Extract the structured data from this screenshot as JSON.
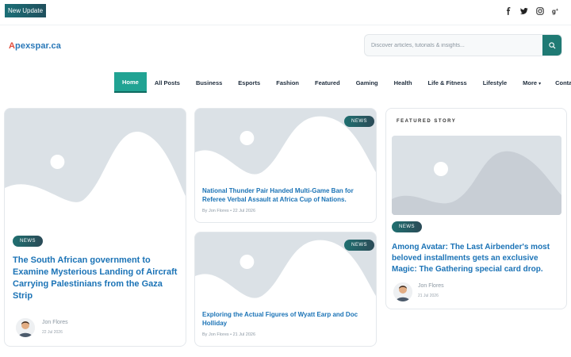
{
  "topbar": {
    "update_label": "New Update",
    "social": [
      "facebook-icon",
      "twitter-icon",
      "instagram-icon",
      "google-plus-icon"
    ]
  },
  "header": {
    "logo_first": "A",
    "logo_rest": "pexspar.ca",
    "search_placeholder": "Discover articles, tutorials & insights..."
  },
  "nav": {
    "items": [
      "Home",
      "All Posts",
      "Business",
      "Esports",
      "Fashion",
      "Featured",
      "Gaming",
      "Health",
      "Life & Fitness",
      "Lifestyle",
      "More",
      "Contact Us"
    ],
    "active": "Home"
  },
  "colors": {
    "accent": "#21a393",
    "title": "#1b73b6",
    "badge": "#1f6f70"
  },
  "posts": {
    "main": {
      "badge": "NEWS",
      "title": "The South African government to Examine Mysterious Landing of Aircraft Carrying Palestinians from the Gaza Strip",
      "author": "Jon Flores",
      "date": "22 Jul 2026"
    },
    "mid1": {
      "badge": "NEWS",
      "title": "National Thunder Pair Handed Multi-Game Ban for Referee Verbal Assault at Africa Cup of Nations.",
      "meta": "By Jon Flores   • 22 Jul 2026"
    },
    "mid2": {
      "badge": "NEWS",
      "title": "Exploring the Actual Figures of Wyatt Earp and Doc Holliday",
      "meta": "By Jon Flores   • 21 Jul 2026"
    },
    "featured": {
      "label": "FEATURED STORY",
      "badge": "NEWS",
      "title": "Among Avatar: The Last Airbender's most beloved installments gets an exclusive Magic: The Gathering special card drop.",
      "author": "Jon Flores",
      "date": "21 Jul 2026"
    }
  }
}
